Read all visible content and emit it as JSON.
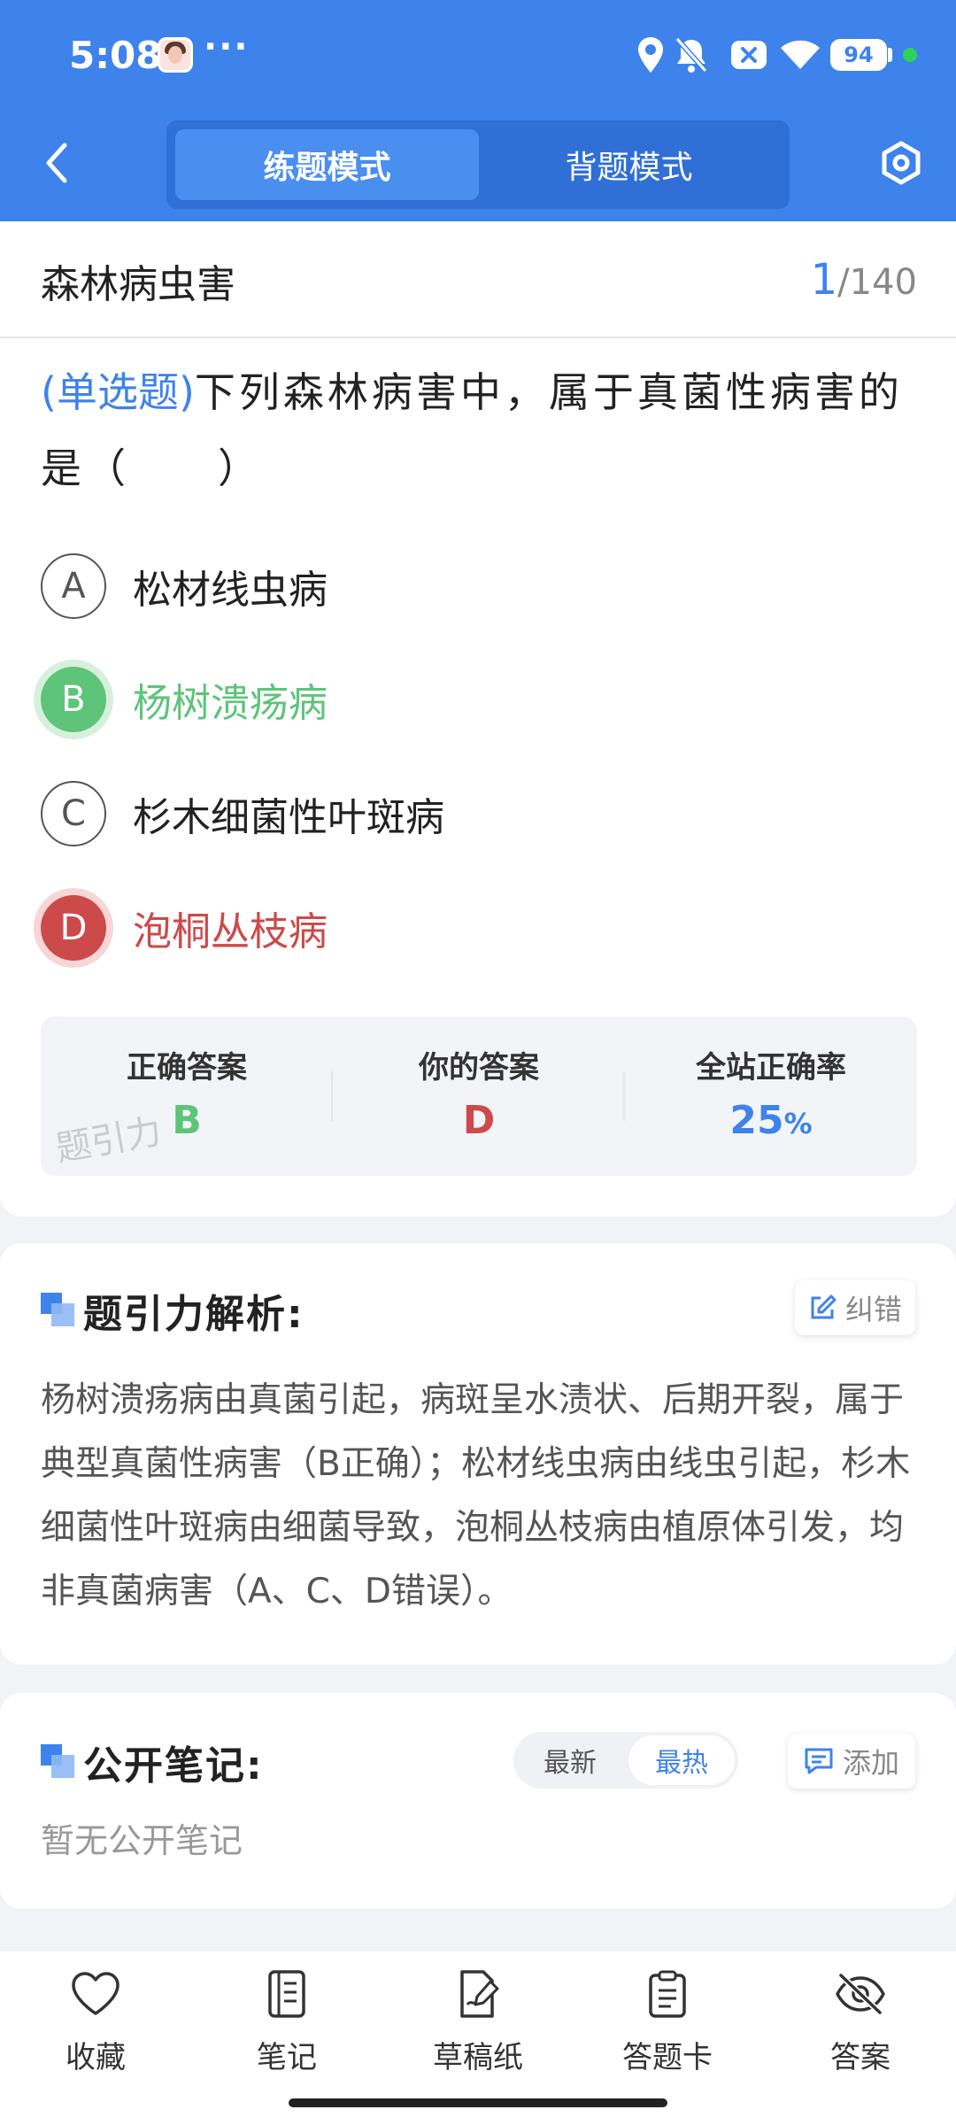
{
  "status_bar": {
    "time": "5:08",
    "more": "···",
    "battery": "94"
  },
  "header": {
    "tabs": [
      {
        "label": "练题模式",
        "active": true
      },
      {
        "label": "背题模式",
        "active": false
      }
    ]
  },
  "question_header": {
    "subject": "森林病虫害",
    "current": "1",
    "total": "/140"
  },
  "question": {
    "type_tag": "(单选题)",
    "text": "下列森林病害中，属于真菌性病害的是（　　）",
    "options": [
      {
        "letter": "A",
        "text": "松材线虫病",
        "state": "normal"
      },
      {
        "letter": "B",
        "text": "杨树溃疡病",
        "state": "correct"
      },
      {
        "letter": "C",
        "text": "杉木细菌性叶斑病",
        "state": "normal"
      },
      {
        "letter": "D",
        "text": "泡桐丛枝病",
        "state": "wrong"
      }
    ]
  },
  "answer_summary": {
    "correct_label": "正确答案",
    "correct_value": "B",
    "yours_label": "你的答案",
    "yours_value": "D",
    "rate_label": "全站正确率",
    "rate_value": "25",
    "rate_unit": "%",
    "watermark": "题引力"
  },
  "analysis": {
    "title": "题引力解析:",
    "report_label": "纠错",
    "text": "杨树溃疡病由真菌引起，病斑呈水渍状、后期开裂，属于典型真菌性病害（B正确）；松材线虫病由线虫引起，杉木细菌性叶斑病由细菌导致，泡桐丛枝病由植原体引发，均非真菌病害（A、C、D错误）。"
  },
  "notes": {
    "title": "公开笔记:",
    "sort_latest": "最新",
    "sort_hot": "最热",
    "add_label": "添加",
    "empty_text": "暂无公开笔记"
  },
  "bottom_nav": [
    {
      "label": "收藏",
      "icon": "heart-icon"
    },
    {
      "label": "笔记",
      "icon": "notebook-icon"
    },
    {
      "label": "草稿纸",
      "icon": "draft-paper-icon"
    },
    {
      "label": "答题卡",
      "icon": "answer-card-icon"
    },
    {
      "label": "答案",
      "icon": "eye-off-icon"
    }
  ],
  "colors": {
    "primary": "#3e82ec",
    "correct": "#5dc47a",
    "wrong": "#cc4a4a"
  }
}
